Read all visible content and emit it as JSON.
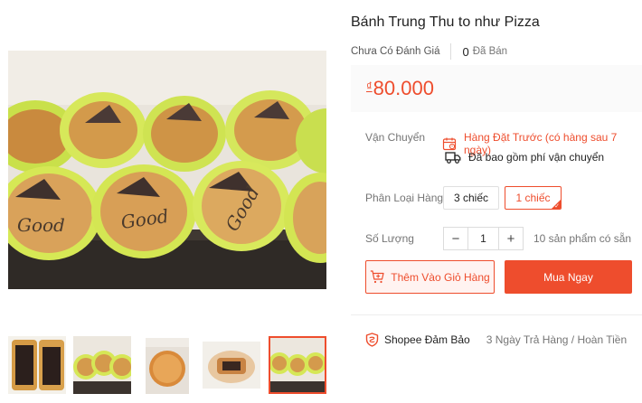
{
  "product": {
    "title": "Bánh Trung Thu to như Pizza",
    "rating_text": "Chưa Có Đánh Giá",
    "sold_count": "0",
    "sold_label": "Đã Bán",
    "currency_symbol": "₫",
    "price": "80.000"
  },
  "shipping": {
    "label": "Vận Chuyển",
    "preorder_text": "Hàng Đặt Trước (có hàng sau 7 ngày)",
    "fee_text": "Đã bao gồm phí vận chuyển"
  },
  "variants": {
    "label": "Phân Loại Hàng",
    "options": [
      "3 chiếc",
      "1 chiếc"
    ],
    "selected": "1 chiếc",
    "check": "✓"
  },
  "quantity": {
    "label": "Số Lượng",
    "minus": "−",
    "value": "1",
    "plus": "+",
    "stock_text": "10 sản phẩm có sẵn"
  },
  "actions": {
    "add_to_cart": "Thêm Vào Giỏ Hàng",
    "buy_now": "Mua Ngay"
  },
  "guarantee": {
    "label": "Shopee Đảm Bảo",
    "text": "3 Ngày Trả Hàng / Hoàn Tiền"
  },
  "gallery": {
    "thumbnail_count": 5,
    "active_index": 4
  },
  "colors": {
    "brand": "#ee4d2d",
    "price_bg": "#fafafa"
  }
}
